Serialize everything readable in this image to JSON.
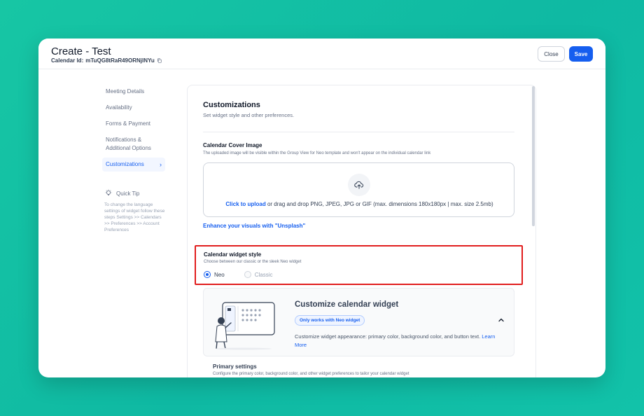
{
  "header": {
    "title": "Create - Test",
    "calendar_id_label": "Calendar Id:",
    "calendar_id_value": "mTuQG8tRaR49ORNjlNYu",
    "close_label": "Close",
    "save_label": "Save"
  },
  "sidebar": {
    "items": [
      {
        "label": "Meeting Details"
      },
      {
        "label": "Availability"
      },
      {
        "label": "Forms & Payment"
      },
      {
        "label": "Notifications & Additional Options"
      },
      {
        "label": "Customizations",
        "active": true
      }
    ]
  },
  "quick_tip": {
    "title": "Quick Tip",
    "body": "To change the language settings of widget follow these steps Settings >> Calendars >> Preferences >> Account Preferences"
  },
  "customizations": {
    "title": "Customizations",
    "subtitle": "Set widget style and other preferences.",
    "cover_image": {
      "title": "Calendar Cover Image",
      "description": "The uploaded image will be visible within the Group View for Neo template and won't appear on the individual calendar link",
      "upload_link": "Click to upload",
      "upload_text": " or drag and drop PNG, JPEG, JPG or GIF (max. dimensions 180x180px | max. size 2.5mb)",
      "unsplash_link": "Enhance your visuals with \"Unsplash\""
    },
    "widget_style": {
      "title": "Calendar widget style",
      "description": "Choose between our classic or the sleek Neo widget",
      "options": [
        {
          "label": "Neo",
          "selected": true
        },
        {
          "label": "Classic",
          "selected": false
        }
      ]
    },
    "customize_widget": {
      "title": "Customize calendar widget",
      "badge": "Only works with Neo widget",
      "description": "Customize widget appearance: primary color, background color, and button text.",
      "learn_more": "Learn More"
    },
    "primary_settings": {
      "title": "Primary settings",
      "description": "Configure the primary color, background color, and other widget preferences to tailor your calendar widget"
    }
  },
  "colors": {
    "accent": "#155eef",
    "highlight_border": "#e11d1d",
    "background_teal": "#17c6a4"
  },
  "icons": [
    "copy-icon",
    "chevron-right-icon",
    "lightbulb-icon",
    "upload-cloud-icon",
    "chevron-up-icon"
  ]
}
